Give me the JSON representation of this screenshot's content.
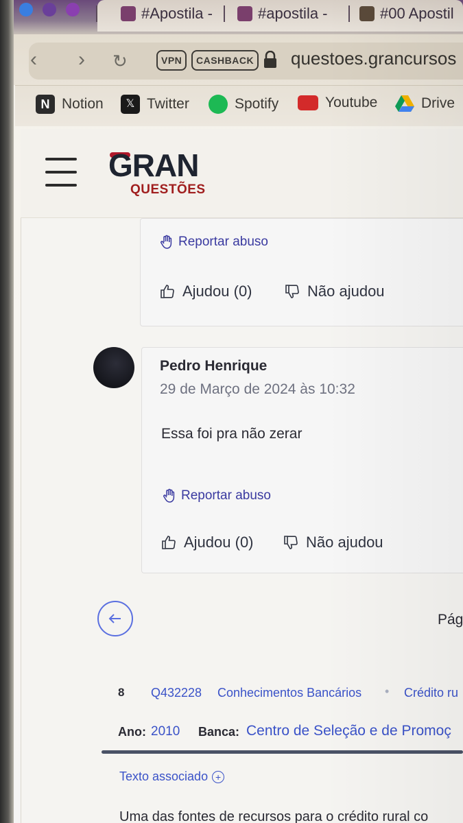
{
  "browser": {
    "tabs": [
      {
        "title": "#Apostila -"
      },
      {
        "title": "#apostila -"
      },
      {
        "title": "#00 Apostil"
      }
    ],
    "badges": {
      "vpn": "VPN",
      "cashback": "CASHBACK"
    },
    "url": "questoes.grancursos",
    "bookmarks": [
      {
        "label": "Notion",
        "icon": "notion-icon",
        "color": "#2b2b2b"
      },
      {
        "label": "Twitter",
        "icon": "twitter-icon",
        "color": "#1a1a1a"
      },
      {
        "label": "Spotify",
        "icon": "spotify-icon",
        "color": "#1db954"
      },
      {
        "label": "Youtube",
        "icon": "youtube-icon",
        "color": "#d32a2a"
      },
      {
        "label": "Drive",
        "icon": "drive-icon",
        "color": "#f4b400"
      }
    ]
  },
  "site": {
    "logo_main": "GRAN",
    "logo_sub": "QUESTÕES",
    "brand_red": "#b0182a"
  },
  "comments": [
    {
      "report_label": "Reportar abuso",
      "helpful_label": "Ajudou (0)",
      "not_helpful_label": "Não ajudou"
    },
    {
      "author": "Pedro Henrique",
      "date": "29 de Março de 2024 às 10:32",
      "text": "Essa foi pra não zerar",
      "report_label": "Reportar abuso",
      "helpful_label": "Ajudou (0)",
      "not_helpful_label": "Não ajudou"
    }
  ],
  "pagination": {
    "label": "Pág"
  },
  "question": {
    "number": "8",
    "id": "Q432228",
    "subject": "Conhecimentos Bancários",
    "topic": "Crédito ru",
    "ano_label": "Ano:",
    "ano_value": "2010",
    "banca_label": "Banca:",
    "banca_value": "Centro de Seleção e de Promoç",
    "associated_text_label": "Texto associado",
    "text_start": "Uma das fontes de recursos para o crédito rural co"
  }
}
